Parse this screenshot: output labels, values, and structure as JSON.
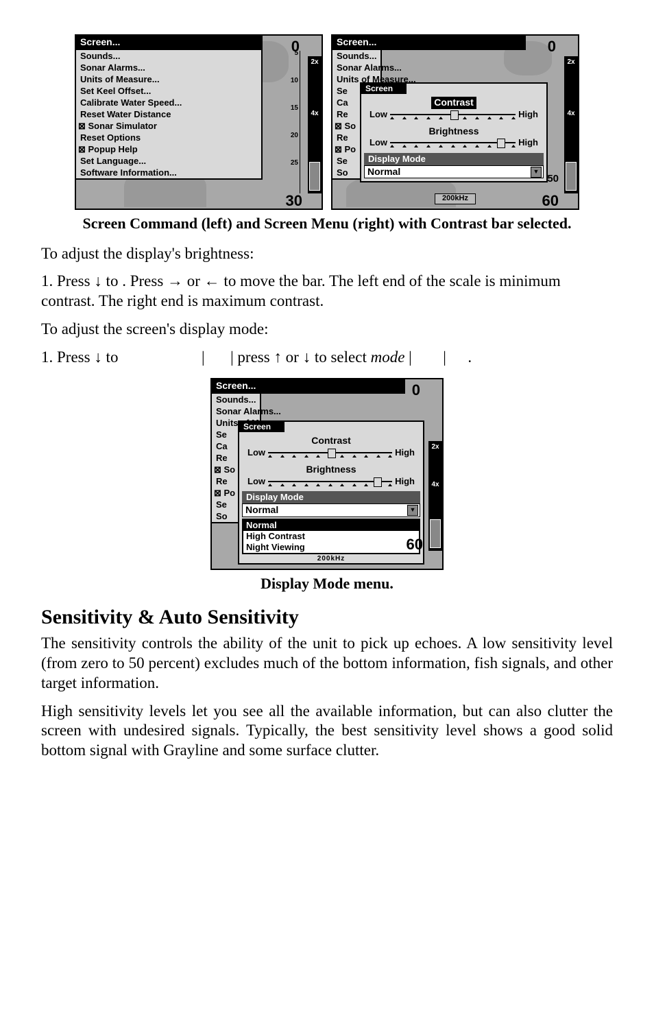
{
  "figure1": {
    "left": {
      "title": "Screen...",
      "items": [
        {
          "label": "Sounds...",
          "chk": false
        },
        {
          "label": "Sonar Alarms...",
          "chk": false
        },
        {
          "label": "Units of Measure...",
          "chk": false
        },
        {
          "label": "Set Keel Offset...",
          "chk": false
        },
        {
          "label": "Calibrate Water Speed...",
          "chk": false
        },
        {
          "label": "Reset Water Distance",
          "chk": false
        },
        {
          "label": "Sonar Simulator",
          "chk": true
        },
        {
          "label": "Reset Options",
          "chk": false
        },
        {
          "label": "Popup Help",
          "chk": true
        },
        {
          "label": "Set Language...",
          "chk": false
        },
        {
          "label": "Software Information...",
          "chk": false
        }
      ],
      "depth_top": "0",
      "depth_ticks": [
        "5",
        "10",
        "15",
        "20",
        "25"
      ],
      "depth_bottom": "30",
      "side_labels": [
        "2x",
        "4x"
      ]
    },
    "right": {
      "title": "Screen...",
      "items": [
        {
          "label": "Sounds...",
          "chk": false
        },
        {
          "label": "Sonar Alarms...",
          "chk": false
        },
        {
          "label": "Units of Measure...",
          "chk": false
        },
        {
          "label": "Se",
          "chk": false
        },
        {
          "label": "Ca",
          "chk": false
        },
        {
          "label": "Re",
          "chk": false
        },
        {
          "label": "So",
          "chk": true
        },
        {
          "label": "Re",
          "chk": false
        },
        {
          "label": "Po",
          "chk": true
        },
        {
          "label": "Se",
          "chk": false
        },
        {
          "label": "So",
          "chk": false
        }
      ],
      "popup": {
        "title": "Screen",
        "contrast": {
          "label": "Contrast",
          "low": "Low",
          "high": "High",
          "selected": true
        },
        "brightness": {
          "label": "Brightness",
          "low": "Low",
          "high": "High",
          "selected": false
        },
        "display_mode_label": "Display Mode",
        "display_mode_value": "Normal"
      },
      "depth_top": "0",
      "depth_bottom": "60",
      "mid_num": "50",
      "freq": "200kHz",
      "side_labels": [
        "2x",
        "4x"
      ]
    },
    "caption": "Screen Command (left) and Screen Menu (right) with Contrast bar selected."
  },
  "text": {
    "brightness_intro": "To adjust the display's brightness:",
    "brightness_step_a": "1. Press ↓ to ",
    "brightness_step_b": ". Press → or ← to move the bar. The left end of the scale is minimum contrast. The right end is maximum contrast.",
    "mode_intro": "To adjust the screen's display mode:",
    "mode_step_a": "1. Press ↓ to ",
    "mode_step_b": "|",
    "mode_step_c": "| press ↑ or ↓ to select ",
    "mode_step_d": "mode",
    "mode_step_e": " |",
    "mode_step_f": "|",
    "mode_step_g": "."
  },
  "figure2": {
    "title": "Screen...",
    "items": [
      {
        "label": "Sounds...",
        "chk": false
      },
      {
        "label": "Sonar Alarms...",
        "chk": false
      },
      {
        "label": "Units of Measure...",
        "chk": false
      },
      {
        "label": "Se",
        "chk": false
      },
      {
        "label": "Ca",
        "chk": false
      },
      {
        "label": "Re",
        "chk": false
      },
      {
        "label": "So",
        "chk": true
      },
      {
        "label": "Re",
        "chk": false
      },
      {
        "label": "Po",
        "chk": true
      },
      {
        "label": "Se",
        "chk": false
      },
      {
        "label": "So",
        "chk": false
      }
    ],
    "popup": {
      "title": "Screen",
      "contrast": {
        "label": "Contrast",
        "low": "Low",
        "high": "High"
      },
      "brightness": {
        "label": "Brightness",
        "low": "Low",
        "high": "High"
      },
      "display_mode_label": "Display Mode",
      "display_mode_value": "Normal",
      "options": [
        "Normal",
        "High Contrast",
        "Night Viewing"
      ]
    },
    "depth_top": "0",
    "depth_bottom": "60",
    "freq": "200kHz",
    "side_labels": [
      "2x",
      "4x"
    ],
    "caption": "Display Mode menu."
  },
  "section": {
    "heading": "Sensitivity & Auto Sensitivity",
    "p1": "The sensitivity controls the ability of the unit to pick up echoes. A low sensitivity level (from zero to 50 percent) excludes much of the bottom information, fish signals, and other target information.",
    "p2": "High sensitivity levels let you see all the available information, but can also clutter the screen with undesired signals. Typically, the best sensitivity level shows a good solid bottom signal with Grayline and some surface clutter."
  }
}
